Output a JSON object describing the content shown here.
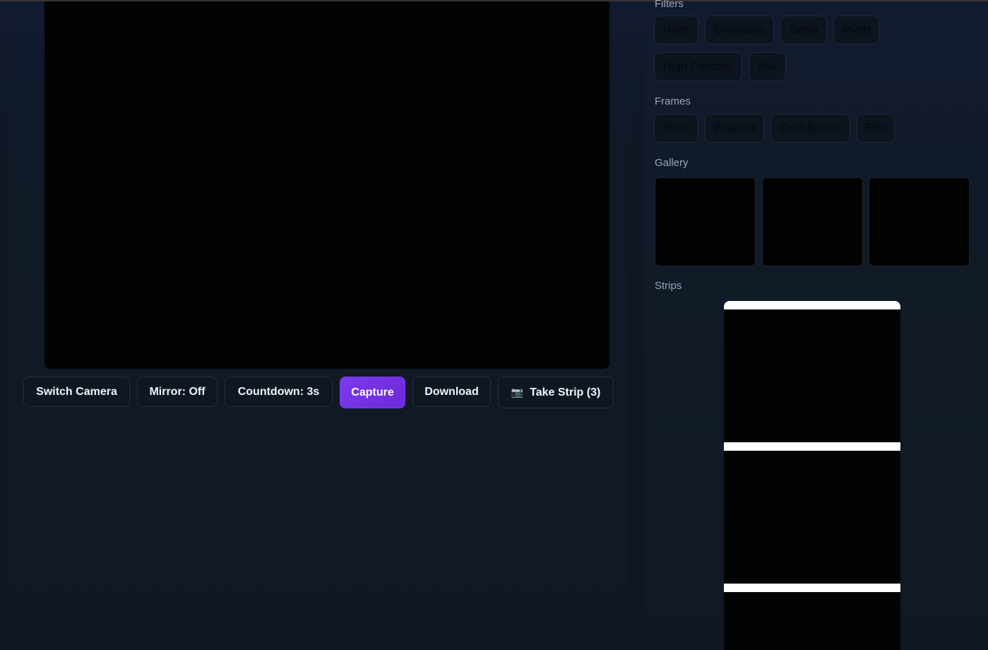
{
  "controls": {
    "switch_camera": "Switch Camera",
    "mirror": "Mirror: Off",
    "countdown": "Countdown: 3s",
    "capture": "Capture",
    "download": "Download",
    "take_strip": "Take Strip (3)",
    "take_strip_icon": "camera-icon"
  },
  "sidebar": {
    "filters_label": "Filters",
    "filters": [
      "None",
      "Grayscale",
      "Sepia",
      "Invert",
      "High Contrast",
      "Blur"
    ],
    "frames_label": "Frames",
    "frames": [
      "None",
      "Polaroid",
      "Gold Border",
      "Film"
    ],
    "gallery_label": "Gallery",
    "strips_label": "Strips"
  },
  "colors": {
    "accent": "#7c3aed",
    "background": "#0f1821",
    "camera": "#020303"
  }
}
